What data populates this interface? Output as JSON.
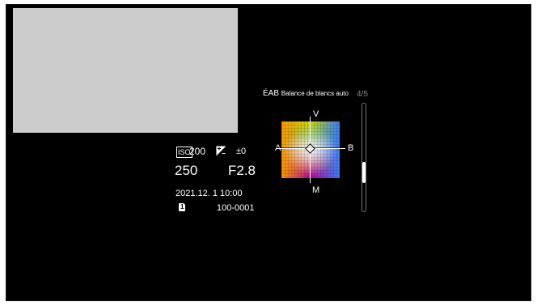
{
  "playback": {
    "iso_label": "ISO",
    "iso_value": "200",
    "exposure_comp_icon": "exposure-compensation-icon",
    "exposure_comp": "±0",
    "shutter_speed": "250",
    "aperture": "F2.8",
    "datetime": "2021.12. 1 10:00",
    "card_icon": "card-slot-icon",
    "card_slot": "1",
    "file_number": "100-0001"
  },
  "white_balance": {
    "icon_text": "ÉAB",
    "title": "Balance de blancs auto",
    "page_indicator": "4/5",
    "labels": {
      "top": "V",
      "bottom": "M",
      "left": "A",
      "right": "B"
    }
  },
  "scrollbar": {
    "position_fraction": 0.68
  },
  "colors": {
    "background": "#000000",
    "thumbnail": "#cccccc",
    "text": "#ffffff",
    "page_indicator": "#888888"
  }
}
